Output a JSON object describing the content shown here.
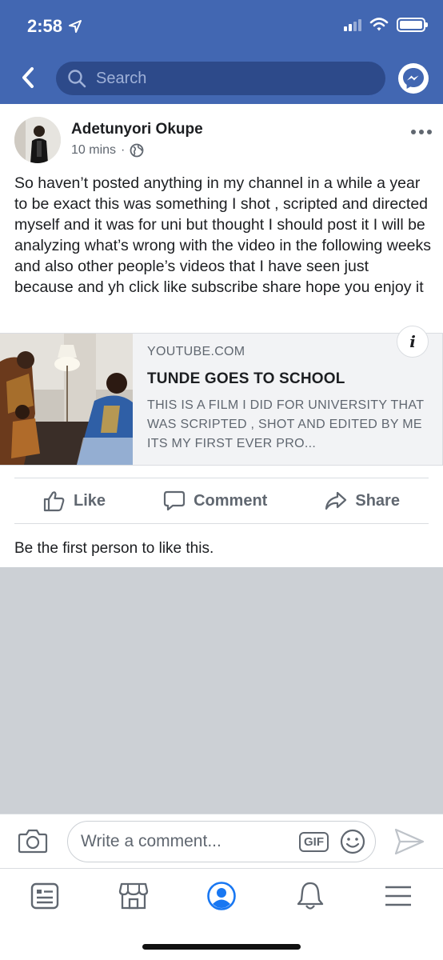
{
  "status_bar": {
    "time": "2:58"
  },
  "header": {
    "search_placeholder": "Search"
  },
  "post": {
    "author": "Adetunyori Okupe",
    "time_ago": "10 mins",
    "separator": "·",
    "text": "So haven’t posted anything in my channel in a while a year to be exact this was something I shot , scripted and directed myself and it was for uni but thought I should post it I will be analyzing what’s wrong with the video in the following weeks and also other people’s videos that I have seen just because and yh click like subscribe share hope you enjoy it"
  },
  "link_preview": {
    "domain": "YOUTUBE.COM",
    "title": "TUNDE GOES TO SCHOOL",
    "description": "THIS IS A FILM I DID FOR UNIVERSITY THAT WAS SCRIPTED , SHOT AND EDITED BY ME ITS MY FIRST EVER PRO...",
    "info_label": "i"
  },
  "actions": {
    "like": "Like",
    "comment": "Comment",
    "share": "Share"
  },
  "likes_summary": "Be the first person to like this.",
  "comment_bar": {
    "placeholder": "Write a comment...",
    "gif_label": "GIF"
  },
  "colors": {
    "brand": "#4267b2",
    "icon_grey": "#606770",
    "active_nav": "#1877f2"
  },
  "icons": {
    "nav": [
      "news-feed-icon",
      "marketplace-icon",
      "profile-icon",
      "notifications-icon",
      "menu-icon"
    ]
  }
}
